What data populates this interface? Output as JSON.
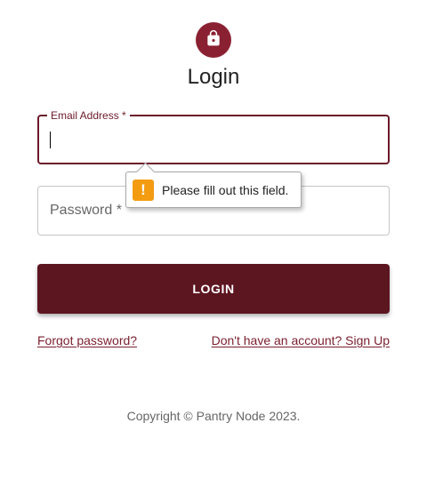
{
  "page": {
    "title": "Login"
  },
  "icons": {
    "avatar": "lock-icon",
    "tooltip": "warning-icon"
  },
  "colors": {
    "primary": "#5c1620",
    "avatar_bg": "#8a2132",
    "link": "#7a1f2e",
    "warning": "#f39c12"
  },
  "form": {
    "email": {
      "label": "Email Address *",
      "value": ""
    },
    "password": {
      "label": "Password *",
      "value": ""
    },
    "submit_label": "LOGIN"
  },
  "validation": {
    "icon_glyph": "!",
    "message": "Please fill out this field."
  },
  "links": {
    "forgot_password": "Forgot password?",
    "sign_up": "Don't have an account? Sign Up"
  },
  "footer": {
    "copyright": "Copyright © Pantry Node 2023."
  }
}
